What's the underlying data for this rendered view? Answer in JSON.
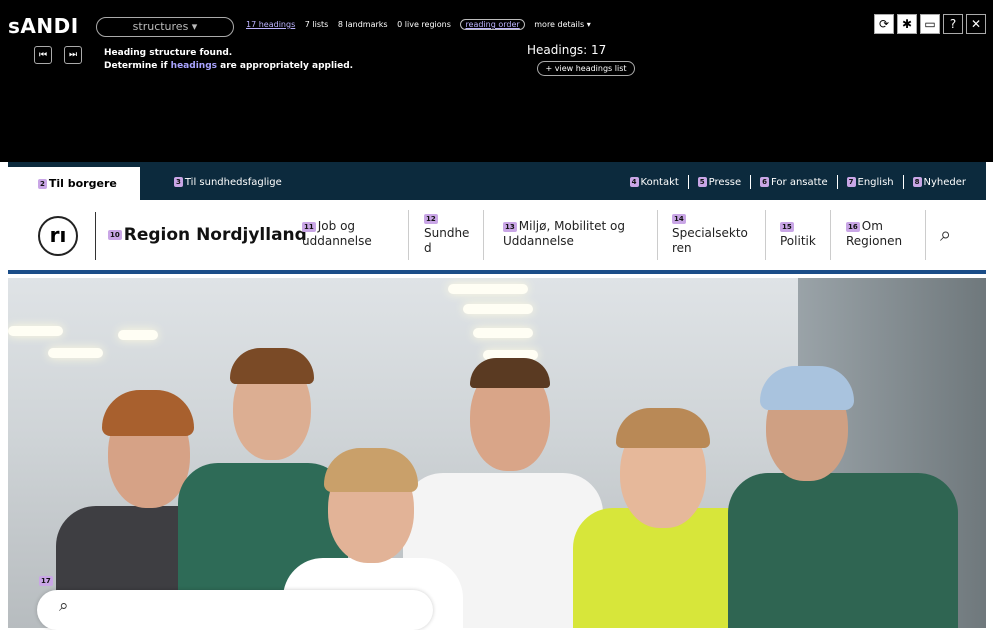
{
  "andi": {
    "logo": "sANDI",
    "mode": "structures ▾",
    "stats": {
      "headings": "17 headings",
      "lists": "7 lists",
      "landmarks": "8 landmarks",
      "live": "0 live regions",
      "reading_order": "reading order",
      "more": "more details ▾"
    },
    "message_line1": "Heading structure found.",
    "message_line2_pre": "Determine if",
    "message_line2_link": "headings",
    "message_line2_post": "are appropriately applied.",
    "heading_count": "Headings: 17",
    "view_list": "+ view headings list",
    "prev": "⏮",
    "next": "⏭",
    "tools": [
      "⟳",
      "✱",
      "▭",
      "?",
      "✕"
    ]
  },
  "topbar": {
    "tab_active": {
      "badge": "2",
      "label": "Til borgere"
    },
    "tab2": {
      "badge": "3",
      "label": "Til sundhedsfaglige"
    },
    "links": [
      {
        "badge": "4",
        "label": "Kontakt"
      },
      {
        "badge": "5",
        "label": "Presse"
      },
      {
        "badge": "6",
        "label": "For ansatte"
      },
      {
        "badge": "7",
        "label": "English"
      },
      {
        "badge": "8",
        "label": "Nyheder"
      }
    ]
  },
  "header": {
    "logo_glyph": "rı",
    "brand_badge": "10",
    "brand": "Region Nordjylland",
    "nav": [
      {
        "badge": "11",
        "line1": "Job og",
        "line2": "uddannelse"
      },
      {
        "badge": "12",
        "line1": "Sundhe",
        "line2": "d"
      },
      {
        "badge": "13",
        "line1": "Miljø, Mobilitet og",
        "line2": "Uddannelse"
      },
      {
        "badge": "14",
        "line1": "Specialsekto",
        "line2": "ren"
      },
      {
        "badge": "15",
        "line1": "Politik",
        "line2": ""
      },
      {
        "badge": "16",
        "line1": "Om",
        "line2": "Regionen"
      }
    ],
    "search_icon": "⌕"
  },
  "hero": {
    "badge": "17",
    "search_icon": "⌕"
  },
  "colors": {
    "toolbar": "#000000",
    "topbar": "#0c2a3d",
    "badge": "#c9a6e6",
    "header_border": "#1b4d88"
  }
}
